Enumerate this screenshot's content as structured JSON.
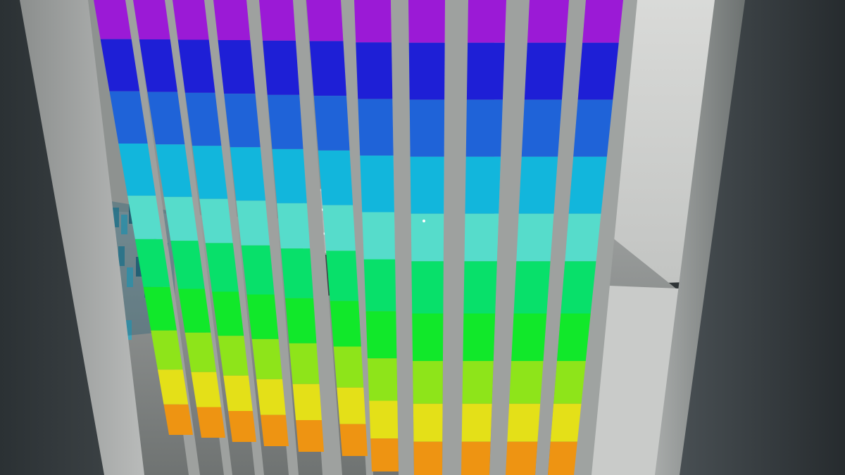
{
  "scene": {
    "description_visible_text": "",
    "wall_colors": {
      "room_dark": "#2f3436",
      "wall_left_light": "#a7aaa9",
      "wall_right_light": "#c4c6c4",
      "floor": "#a9acaa",
      "far_wall": "#d7d8d6",
      "right_pillar": "#3a4043",
      "slat_gray": "#9ea19f"
    },
    "rainbow_bands": [
      "#9b1ad6",
      "#1e1fd6",
      "#1f63d8",
      "#12b6dc",
      "#56dccb",
      "#08e06a",
      "#11e82a",
      "#8ee41a",
      "#e4e018",
      "#ee9412"
    ],
    "objects": {
      "glass_cube_icon": "glass-cube",
      "crystal_cluster_icon": "crystal-cluster",
      "crosshair_icon": "crosshair-dot"
    }
  }
}
